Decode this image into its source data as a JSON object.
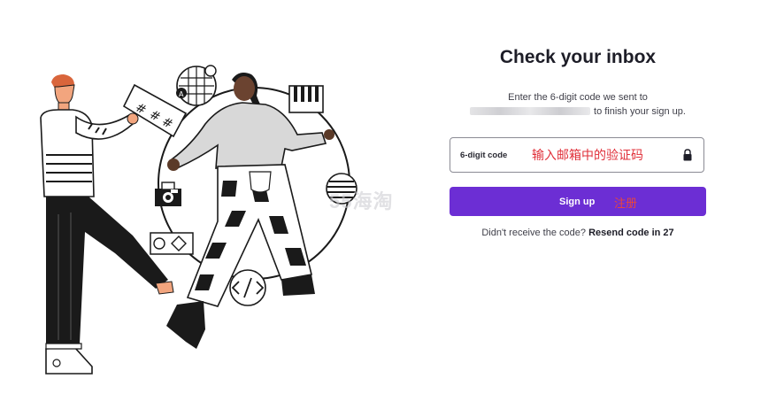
{
  "panel": {
    "title": "Check your inbox",
    "desc_line1": "Enter the 6-digit code we sent to",
    "desc_line2_suffix": "to finish your sign up.",
    "code_field": {
      "label": "6-digit code",
      "annotation": "输入邮箱中的验证码",
      "icon": "lock-icon"
    },
    "signup_button": {
      "label": "Sign up",
      "annotation": "注册"
    },
    "resend": {
      "prompt": "Didn't receive the code?",
      "link": "Resend code in 27"
    }
  },
  "watermark": "55海淘",
  "colors": {
    "primary": "#6c2ed4",
    "text": "#1d1d27",
    "annotation": "#e0303a"
  }
}
